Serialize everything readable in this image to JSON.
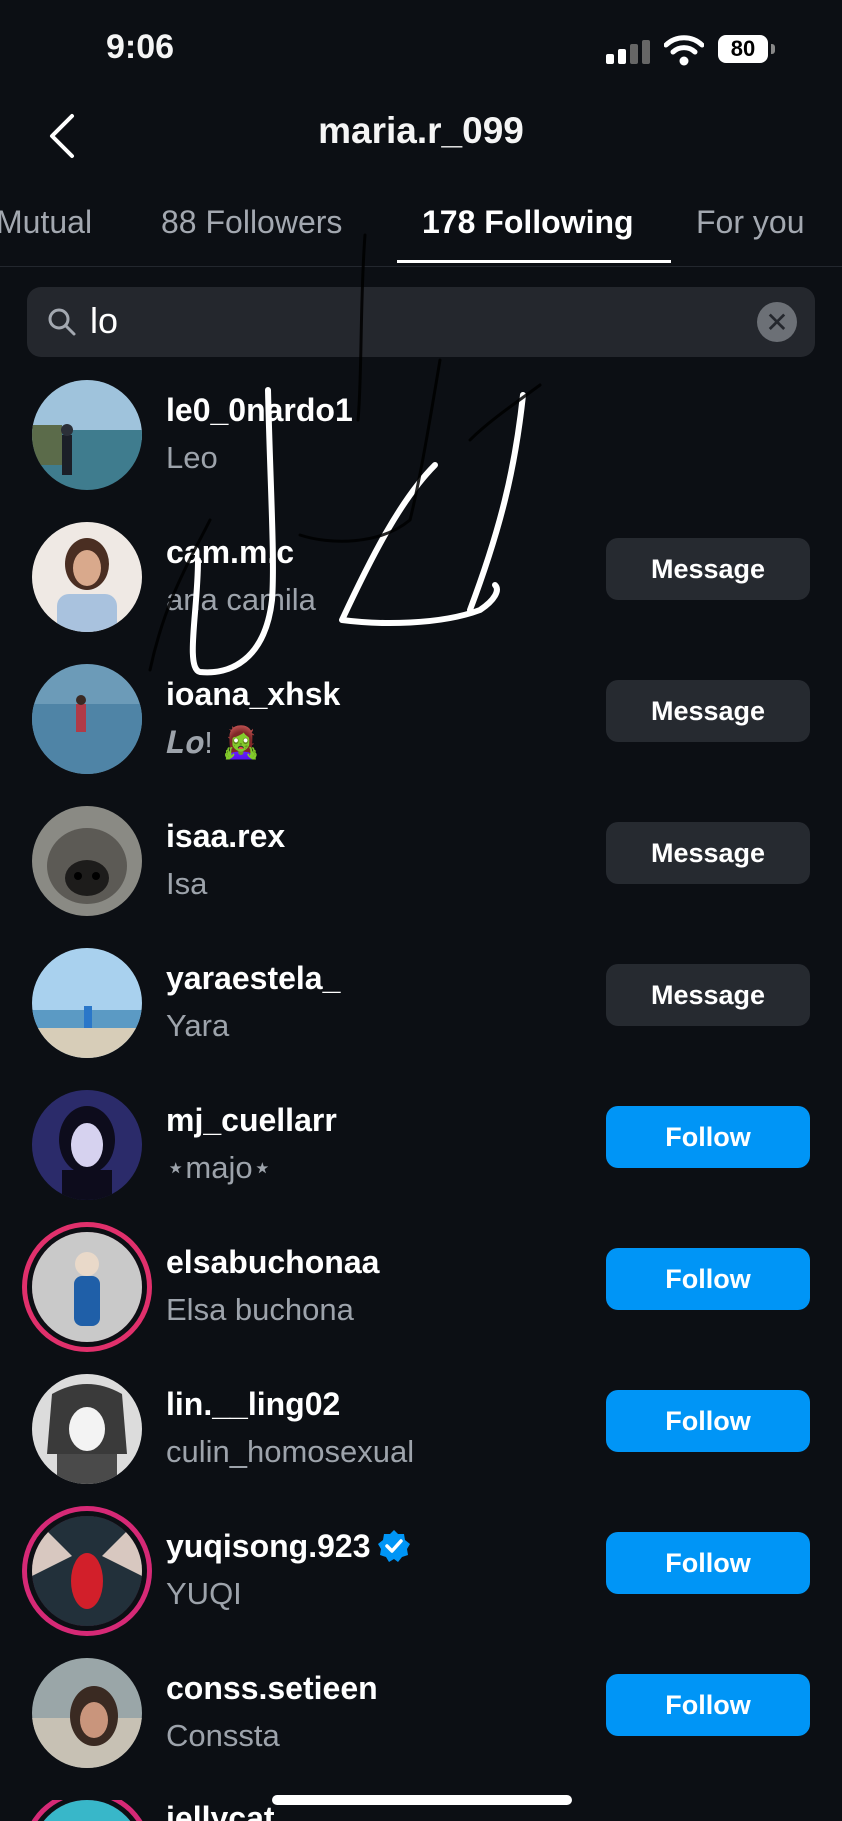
{
  "status_bar": {
    "time": "9:06",
    "battery": "80"
  },
  "header": {
    "title": "maria.r_099"
  },
  "tabs": [
    {
      "label": "Mutual"
    },
    {
      "label": "88 Followers"
    },
    {
      "label": "178 Following"
    },
    {
      "label": "For you"
    }
  ],
  "search": {
    "value": "lo"
  },
  "users": [
    {
      "username": "le0_0nardo1",
      "name": "Leo",
      "button": ""
    },
    {
      "username": "cam.m.c",
      "name": "ana camila",
      "button": "Message"
    },
    {
      "username": "ioana_xhsk",
      "name": "𝑳𝒐! 🧟‍♀️",
      "button": "Message"
    },
    {
      "username": "isaa.rex",
      "name": "Isa",
      "button": "Message"
    },
    {
      "username": "yaraestela_",
      "name": "Yara",
      "button": "Message"
    },
    {
      "username": "mj_cuellarr",
      "name": "⋆majo⋆",
      "button": "Follow"
    },
    {
      "username": "elsabuchonaa",
      "name": "Elsa buchona",
      "button": "Follow"
    },
    {
      "username": "lin.__ling02",
      "name": "culin_homosexual",
      "button": "Follow"
    },
    {
      "username": "yuqisong.923",
      "name": "YUQI",
      "button": "Follow"
    },
    {
      "username": "conss.setieen",
      "name": "Conssta",
      "button": "Follow"
    },
    {
      "username": "iellycat",
      "name": "",
      "button": ""
    }
  ],
  "colors": {
    "background": "#0c0f14",
    "follow": "#0095f6",
    "message": "#262a30"
  }
}
